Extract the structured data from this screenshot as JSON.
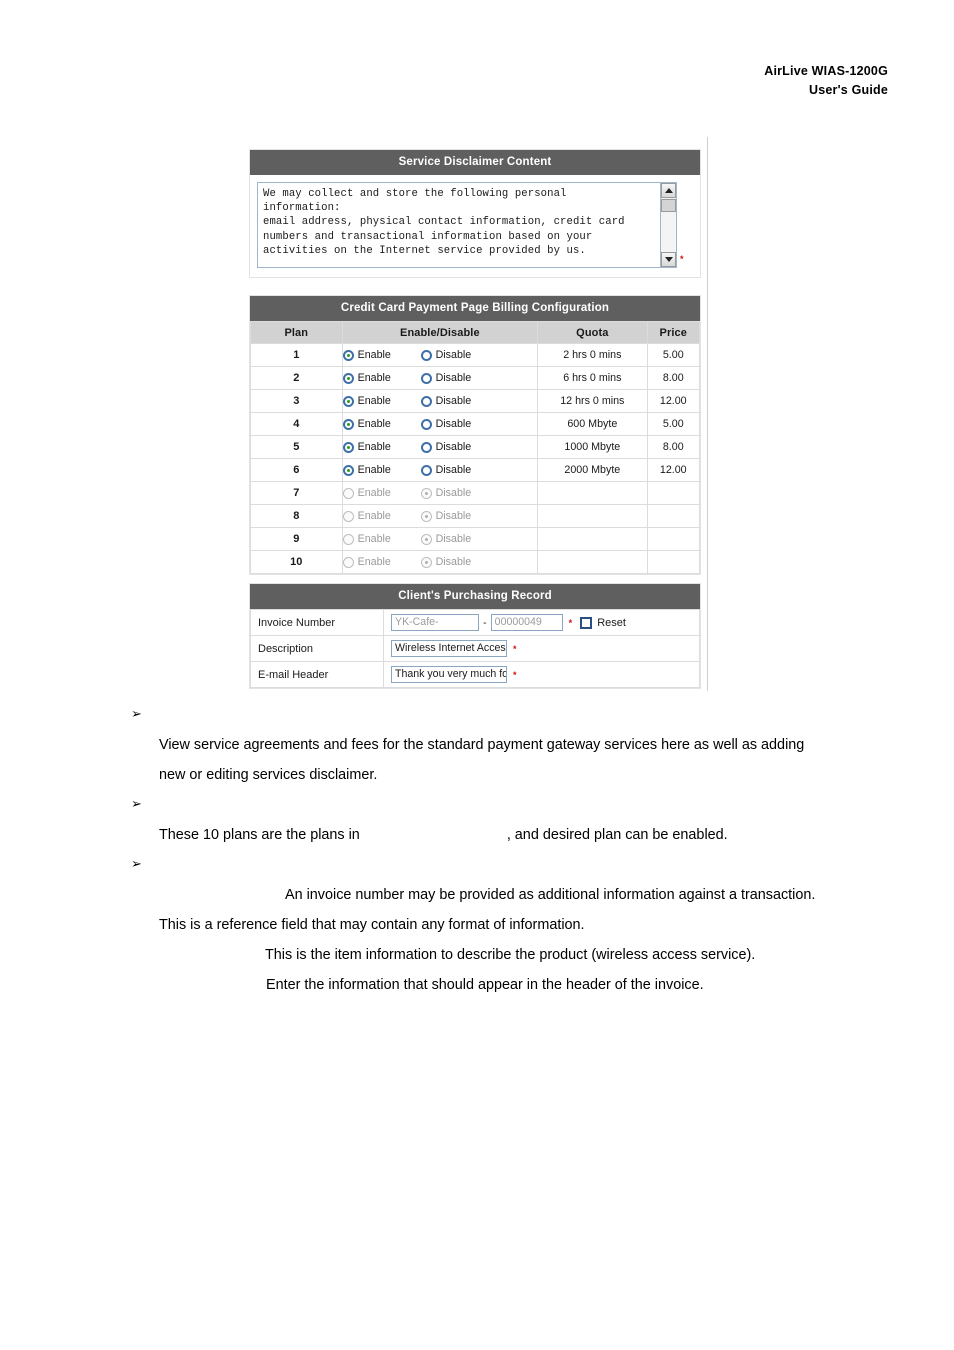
{
  "header": {
    "line1": "AirLive  WIAS-1200G",
    "line2": "User's  Guide"
  },
  "disclaimer": {
    "title": "Service Disclaimer Content",
    "content": "We may collect and store the following personal\ninformation:\nemail address, physical contact information, credit card\nnumbers and transactional information based on your\nactivities on the Internet service provided by us.",
    "required_marker": "*",
    "scroll_up_icon": "scroll-up-arrow",
    "scroll_down_icon": "scroll-down-arrow"
  },
  "billing": {
    "title": "Credit Card Payment Page Billing Configuration",
    "columns": [
      "Plan",
      "Enable/Disable",
      "Quota",
      "Price"
    ],
    "enable_label": "Enable",
    "disable_label": "Disable",
    "rows": [
      {
        "plan": "1",
        "state": "enable",
        "quota": "2 hrs 0 mins",
        "price": "5.00"
      },
      {
        "plan": "2",
        "state": "enable",
        "quota": "6 hrs 0 mins",
        "price": "8.00"
      },
      {
        "plan": "3",
        "state": "enable",
        "quota": "12 hrs 0 mins",
        "price": "12.00"
      },
      {
        "plan": "4",
        "state": "enable",
        "quota": "600 Mbyte",
        "price": "5.00"
      },
      {
        "plan": "5",
        "state": "enable",
        "quota": "1000 Mbyte",
        "price": "8.00"
      },
      {
        "plan": "6",
        "state": "enable",
        "quota": "2000 Mbyte",
        "price": "12.00"
      },
      {
        "plan": "7",
        "state": "disable",
        "quota": "",
        "price": ""
      },
      {
        "plan": "8",
        "state": "disable",
        "quota": "",
        "price": ""
      },
      {
        "plan": "9",
        "state": "disable",
        "quota": "",
        "price": ""
      },
      {
        "plan": "10",
        "state": "disable",
        "quota": "",
        "price": ""
      }
    ]
  },
  "record": {
    "title": "Client's Purchasing Record",
    "invoice": {
      "label": "Invoice Number",
      "prefix_value": "YK-Cafe-",
      "separator": "-",
      "serial_value": "00000049",
      "required_marker": "*",
      "reset_label": "Reset",
      "reset_checked": false
    },
    "description": {
      "label": "Description",
      "value": "Wireless Internet Acces",
      "required_marker": "*"
    },
    "email_header": {
      "label": "E-mail Header",
      "value": "Thank you very much fo",
      "required_marker": "*"
    }
  },
  "body": {
    "bullet_glyph": "➢",
    "paragraphs": [
      "View service agreements and fees for the standard payment gateway services here as well as adding",
      "new or editing services disclaimer.",
      "These 10 plans are the plans in",
      ", and desired plan can be enabled.",
      "An invoice number may be provided as additional information against a transaction.",
      "This is a reference field that may contain any format of information.",
      "This is the item information to describe the product (wireless access service).",
      "Enter the information that should appear in the header of the invoice."
    ]
  }
}
